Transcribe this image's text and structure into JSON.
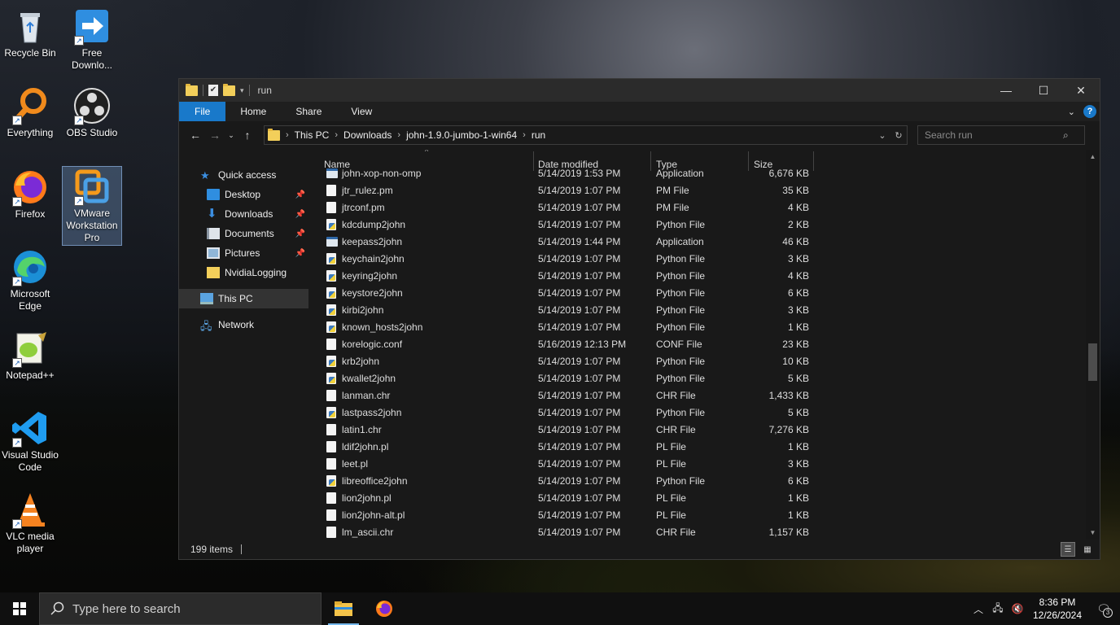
{
  "desktop": {
    "icons": [
      {
        "label": "Recycle Bin"
      },
      {
        "label": "Free Downlo..."
      },
      {
        "label": "Everything"
      },
      {
        "label": "OBS Studio"
      },
      {
        "label": "Firefox"
      },
      {
        "label": "VMware Workstation Pro"
      },
      {
        "label": "Microsoft Edge"
      },
      {
        "label": "Notepad++"
      },
      {
        "label": "Visual Studio Code"
      },
      {
        "label": "VLC media player"
      }
    ]
  },
  "window": {
    "title": "run",
    "ribbon_tabs": [
      "File",
      "Home",
      "Share",
      "View"
    ],
    "breadcrumb": [
      "This PC",
      "Downloads",
      "john-1.9.0-jumbo-1-win64",
      "run"
    ],
    "search_placeholder": "Search run",
    "nav": {
      "quick_access": "Quick access",
      "items": [
        "Desktop",
        "Downloads",
        "Documents",
        "Pictures",
        "NvidiaLogging"
      ],
      "this_pc": "This PC",
      "network": "Network"
    },
    "columns": {
      "name": "Name",
      "date": "Date modified",
      "type": "Type",
      "size": "Size"
    },
    "files": [
      {
        "name": "john-xop-non-omp",
        "date": "5/14/2019 1:53 PM",
        "type": "Application",
        "size": "6,676 KB",
        "icon": "application"
      },
      {
        "name": "jtr_rulez.pm",
        "date": "5/14/2019 1:07 PM",
        "type": "PM File",
        "size": "35 KB",
        "icon": "file"
      },
      {
        "name": "jtrconf.pm",
        "date": "5/14/2019 1:07 PM",
        "type": "PM File",
        "size": "4 KB",
        "icon": "file"
      },
      {
        "name": "kdcdump2john",
        "date": "5/14/2019 1:07 PM",
        "type": "Python File",
        "size": "2 KB",
        "icon": "python"
      },
      {
        "name": "keepass2john",
        "date": "5/14/2019 1:44 PM",
        "type": "Application",
        "size": "46 KB",
        "icon": "application"
      },
      {
        "name": "keychain2john",
        "date": "5/14/2019 1:07 PM",
        "type": "Python File",
        "size": "3 KB",
        "icon": "python"
      },
      {
        "name": "keyring2john",
        "date": "5/14/2019 1:07 PM",
        "type": "Python File",
        "size": "4 KB",
        "icon": "python"
      },
      {
        "name": "keystore2john",
        "date": "5/14/2019 1:07 PM",
        "type": "Python File",
        "size": "6 KB",
        "icon": "python"
      },
      {
        "name": "kirbi2john",
        "date": "5/14/2019 1:07 PM",
        "type": "Python File",
        "size": "3 KB",
        "icon": "python"
      },
      {
        "name": "known_hosts2john",
        "date": "5/14/2019 1:07 PM",
        "type": "Python File",
        "size": "1 KB",
        "icon": "python"
      },
      {
        "name": "korelogic.conf",
        "date": "5/16/2019 12:13 PM",
        "type": "CONF File",
        "size": "23 KB",
        "icon": "file"
      },
      {
        "name": "krb2john",
        "date": "5/14/2019 1:07 PM",
        "type": "Python File",
        "size": "10 KB",
        "icon": "python"
      },
      {
        "name": "kwallet2john",
        "date": "5/14/2019 1:07 PM",
        "type": "Python File",
        "size": "5 KB",
        "icon": "python"
      },
      {
        "name": "lanman.chr",
        "date": "5/14/2019 1:07 PM",
        "type": "CHR File",
        "size": "1,433 KB",
        "icon": "file"
      },
      {
        "name": "lastpass2john",
        "date": "5/14/2019 1:07 PM",
        "type": "Python File",
        "size": "5 KB",
        "icon": "python"
      },
      {
        "name": "latin1.chr",
        "date": "5/14/2019 1:07 PM",
        "type": "CHR File",
        "size": "7,276 KB",
        "icon": "file"
      },
      {
        "name": "ldif2john.pl",
        "date": "5/14/2019 1:07 PM",
        "type": "PL File",
        "size": "1 KB",
        "icon": "file"
      },
      {
        "name": "leet.pl",
        "date": "5/14/2019 1:07 PM",
        "type": "PL File",
        "size": "3 KB",
        "icon": "file"
      },
      {
        "name": "libreoffice2john",
        "date": "5/14/2019 1:07 PM",
        "type": "Python File",
        "size": "6 KB",
        "icon": "python"
      },
      {
        "name": "lion2john.pl",
        "date": "5/14/2019 1:07 PM",
        "type": "PL File",
        "size": "1 KB",
        "icon": "file"
      },
      {
        "name": "lion2john-alt.pl",
        "date": "5/14/2019 1:07 PM",
        "type": "PL File",
        "size": "1 KB",
        "icon": "file"
      },
      {
        "name": "lm_ascii.chr",
        "date": "5/14/2019 1:07 PM",
        "type": "CHR File",
        "size": "1,157 KB",
        "icon": "file"
      }
    ],
    "status": {
      "item_count": "199 items"
    }
  },
  "taskbar": {
    "search_placeholder": "Type here to search",
    "time": "8:36 PM",
    "date": "12/26/2024",
    "notification_count": "3"
  },
  "colors": {
    "accent": "#1979ca",
    "window_bg": "#191919",
    "taskbar_bg": "#101010"
  }
}
